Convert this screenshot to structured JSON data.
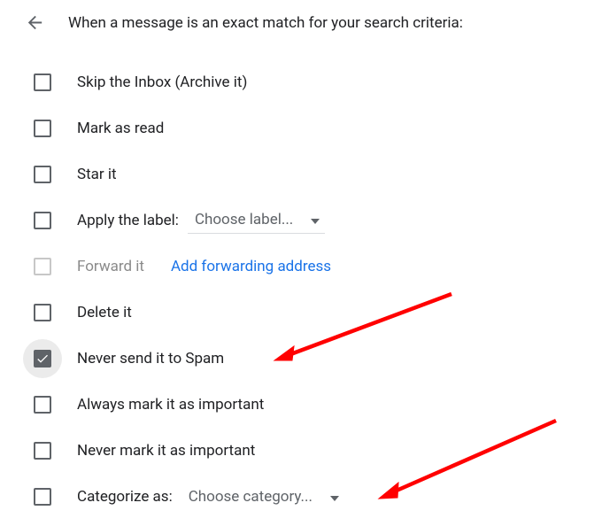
{
  "header": {
    "title": "When a message is an exact match for your search criteria:"
  },
  "options": {
    "skip_inbox": {
      "label": "Skip the Inbox (Archive it)",
      "checked": false
    },
    "mark_read": {
      "label": "Mark as read",
      "checked": false
    },
    "star": {
      "label": "Star it",
      "checked": false
    },
    "apply_label": {
      "label": "Apply the label:",
      "checked": false,
      "dropdown": "Choose label..."
    },
    "forward": {
      "label": "Forward it",
      "checked": false,
      "disabled": true,
      "link": "Add forwarding address"
    },
    "delete": {
      "label": "Delete it",
      "checked": false
    },
    "never_spam": {
      "label": "Never send it to Spam",
      "checked": true
    },
    "always_important": {
      "label": "Always mark it as important",
      "checked": false
    },
    "never_important": {
      "label": "Never mark it as important",
      "checked": false
    },
    "categorize": {
      "label": "Categorize as:",
      "checked": false,
      "dropdown": "Choose category..."
    }
  }
}
